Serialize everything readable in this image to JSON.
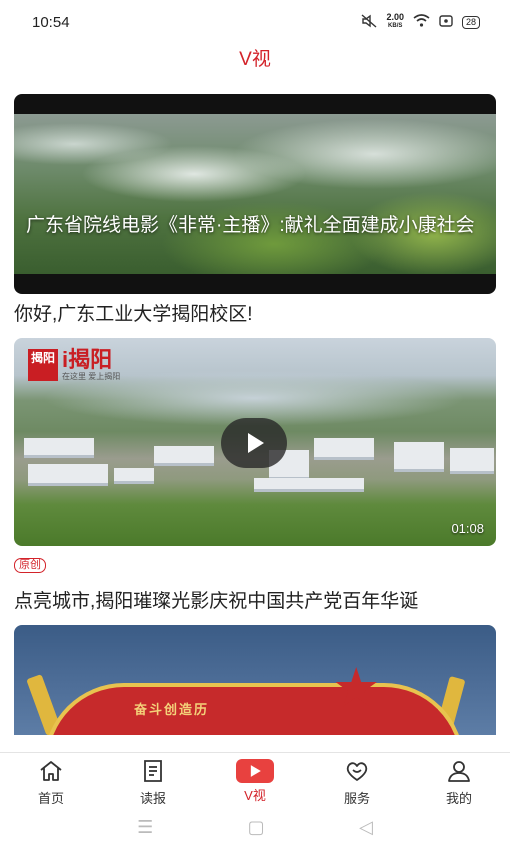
{
  "status_bar": {
    "time": "10:54",
    "net_speed_value": "2.00",
    "net_speed_unit": "KB/S",
    "battery": "28"
  },
  "header": {
    "title": "V视"
  },
  "feed": [
    {
      "caption": "广东省院线电影《非常·主播》:献礼全面建成小康社会"
    },
    {
      "title": "你好,广东工业大学揭阳校区!",
      "logo_mark": "揭阳",
      "logo_text": "i揭阳",
      "logo_sub": "在这里 爱上揭阳",
      "duration": "01:08",
      "tag": "原创"
    },
    {
      "title": "点亮城市,揭阳璀璨光影庆祝中国共产党百年华诞",
      "banner_text": "奋斗创造历"
    }
  ],
  "tab_bar": {
    "items": [
      {
        "label": "首页",
        "icon": "home-icon"
      },
      {
        "label": "读报",
        "icon": "newspaper-icon"
      },
      {
        "label": "V视",
        "icon": "video-play-icon",
        "active": true
      },
      {
        "label": "服务",
        "icon": "heart-smile-icon"
      },
      {
        "label": "我的",
        "icon": "user-icon"
      }
    ]
  },
  "colors": {
    "accent": "#d3232a"
  }
}
